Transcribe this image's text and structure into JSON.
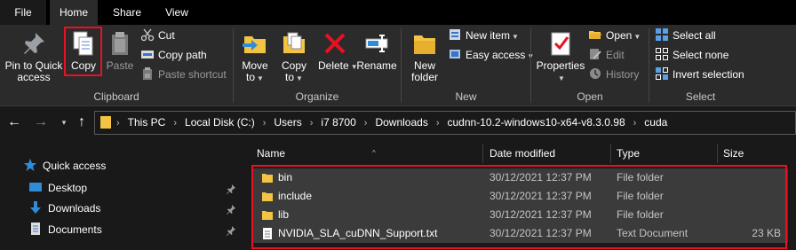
{
  "colors": {
    "highlight": "#e81123",
    "folder": "#f3c344",
    "accent": "#2f8cd8",
    "delete_red": "#e81123"
  },
  "tabs": [
    {
      "label": "File"
    },
    {
      "label": "Home"
    },
    {
      "label": "Share"
    },
    {
      "label": "View"
    }
  ],
  "ribbon": {
    "clipboard": {
      "label": "Clipboard",
      "pin_quick_access": "Pin to Quick access",
      "copy": "Copy",
      "paste": "Paste",
      "cut": "Cut",
      "copy_path": "Copy path",
      "paste_shortcut": "Paste shortcut"
    },
    "organize": {
      "label": "Organize",
      "move_to": "Move to",
      "copy_to": "Copy to",
      "delete": "Delete",
      "rename": "Rename"
    },
    "new": {
      "label": "New",
      "new_folder": "New folder",
      "new_item": "New item",
      "easy_access": "Easy access"
    },
    "open": {
      "label": "Open",
      "properties": "Properties",
      "open": "Open",
      "edit": "Edit",
      "history": "History"
    },
    "select": {
      "label": "Select",
      "select_all": "Select all",
      "select_none": "Select none",
      "invert_selection": "Invert selection"
    }
  },
  "address": {
    "breadcrumbs": [
      "This PC",
      "Local Disk (C:)",
      "Users",
      "i7 8700",
      "Downloads",
      "cudnn-10.2-windows10-x64-v8.3.0.98",
      "cuda"
    ]
  },
  "nav_pane": {
    "items": [
      {
        "label": "Quick access",
        "icon": "star-icon"
      },
      {
        "label": "Desktop",
        "icon": "desktop-icon"
      },
      {
        "label": "Downloads",
        "icon": "download-icon"
      },
      {
        "label": "Documents",
        "icon": "document-icon"
      }
    ]
  },
  "file_list": {
    "columns": {
      "name": "Name",
      "date": "Date modified",
      "type": "Type",
      "size": "Size"
    },
    "rows": [
      {
        "name": "bin",
        "date": "30/12/2021 12:37 PM",
        "type": "File folder",
        "size": "",
        "icon": "folder-icon"
      },
      {
        "name": "include",
        "date": "30/12/2021 12:37 PM",
        "type": "File folder",
        "size": "",
        "icon": "folder-icon"
      },
      {
        "name": "lib",
        "date": "30/12/2021 12:37 PM",
        "type": "File folder",
        "size": "",
        "icon": "folder-icon"
      },
      {
        "name": "NVIDIA_SLA_cuDNN_Support.txt",
        "date": "30/12/2021 12:37 PM",
        "type": "Text Document",
        "size": "23 KB",
        "icon": "text-file-icon"
      }
    ]
  }
}
